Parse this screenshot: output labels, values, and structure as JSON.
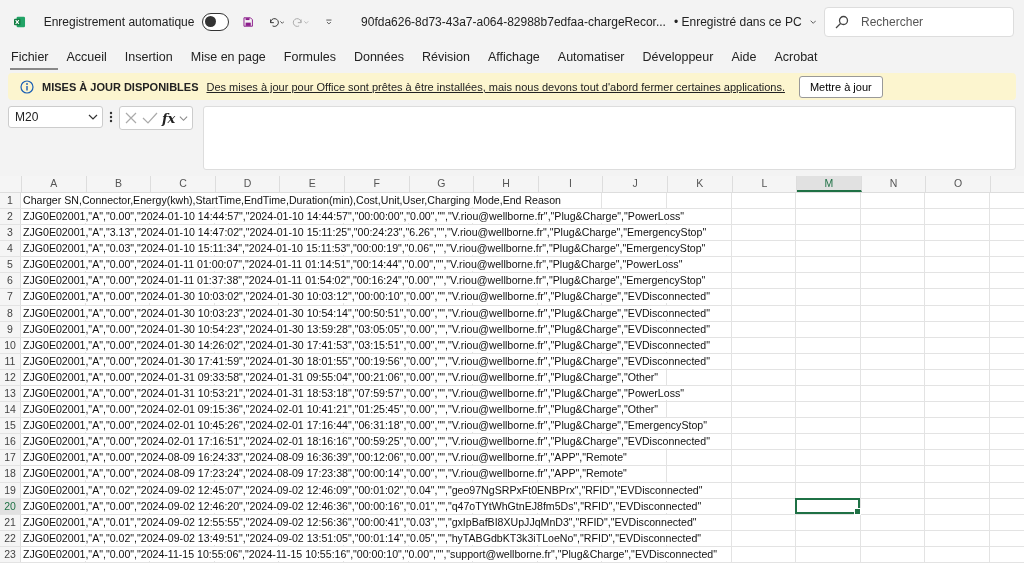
{
  "title_bar": {
    "autosave_label": "Enregistrement automatique",
    "autosave_on": false,
    "file_name": "90fda626-8d73-43a7-a064-82988b7edfaa-chargeRecor...",
    "save_status": "• Enregistré dans ce PC",
    "search": {
      "placeholder": "Rechercher"
    }
  },
  "menu": [
    {
      "label": "Fichier",
      "selected": true
    },
    {
      "label": "Accueil",
      "selected": false
    },
    {
      "label": "Insertion",
      "selected": false
    },
    {
      "label": "Mise en page",
      "selected": false
    },
    {
      "label": "Formules",
      "selected": false
    },
    {
      "label": "Données",
      "selected": false
    },
    {
      "label": "Révision",
      "selected": false
    },
    {
      "label": "Affichage",
      "selected": false
    },
    {
      "label": "Automatiser",
      "selected": false
    },
    {
      "label": "Développeur",
      "selected": false
    },
    {
      "label": "Aide",
      "selected": false
    },
    {
      "label": "Acrobat",
      "selected": false
    }
  ],
  "update_bar": {
    "title": "MISES À JOUR DISPONIBLES",
    "message": "Des mises à jour pour Office sont prêtes à être installées, mais nous devons tout d'abord fermer certaines applications.",
    "button": "Mettre à jour"
  },
  "formula_bar": {
    "name_box": "M20",
    "fx": "fx"
  },
  "columns": [
    {
      "label": "A",
      "selected": false
    },
    {
      "label": "B",
      "selected": false
    },
    {
      "label": "C",
      "selected": false
    },
    {
      "label": "D",
      "selected": false
    },
    {
      "label": "E",
      "selected": false
    },
    {
      "label": "F",
      "selected": false
    },
    {
      "label": "G",
      "selected": false
    },
    {
      "label": "H",
      "selected": false
    },
    {
      "label": "I",
      "selected": false
    },
    {
      "label": "J",
      "selected": false
    },
    {
      "label": "K",
      "selected": false
    },
    {
      "label": "L",
      "selected": false
    },
    {
      "label": "M",
      "selected": true
    },
    {
      "label": "N",
      "selected": false
    },
    {
      "label": "O",
      "selected": false
    }
  ],
  "rows": [
    {
      "number": "1",
      "selected": false,
      "text": "Charger SN,Connector,Energy(kwh),StartTime,EndTime,Duration(min),Cost,Unit,User,Charging Mode,End Reason"
    },
    {
      "number": "2",
      "selected": false,
      "text": "ZJG0E02001,\"A\",\"0.00\",\"2024-01-10 14:44:57\",\"2024-01-10 14:44:57\",\"00:00:00\",\"0.00\",\"\",\"V.riou@wellborne.fr\",\"Plug&Charge\",\"PowerLoss\""
    },
    {
      "number": "3",
      "selected": false,
      "text": "ZJG0E02001,\"A\",\"3.13\",\"2024-01-10 14:47:02\",\"2024-01-10 15:11:25\",\"00:24:23\",\"6.26\",\"\",\"V.riou@wellborne.fr\",\"Plug&Charge\",\"EmergencyStop\""
    },
    {
      "number": "4",
      "selected": false,
      "text": "ZJG0E02001,\"A\",\"0.03\",\"2024-01-10 15:11:34\",\"2024-01-10 15:11:53\",\"00:00:19\",\"0.06\",\"\",\"V.riou@wellborne.fr\",\"Plug&Charge\",\"EmergencyStop\""
    },
    {
      "number": "5",
      "selected": false,
      "text": "ZJG0E02001,\"A\",\"0.00\",\"2024-01-11 01:00:07\",\"2024-01-11 01:14:51\",\"00:14:44\",\"0.00\",\"\",\"V.riou@wellborne.fr\",\"Plug&Charge\",\"PowerLoss\""
    },
    {
      "number": "6",
      "selected": false,
      "text": "ZJG0E02001,\"A\",\"0.00\",\"2024-01-11 01:37:38\",\"2024-01-11 01:54:02\",\"00:16:24\",\"0.00\",\"\",\"V.riou@wellborne.fr\",\"Plug&Charge\",\"EmergencyStop\""
    },
    {
      "number": "7",
      "selected": false,
      "text": "ZJG0E02001,\"A\",\"0.00\",\"2024-01-30 10:03:02\",\"2024-01-30 10:03:12\",\"00:00:10\",\"0.00\",\"\",\"V.riou@wellborne.fr\",\"Plug&Charge\",\"EVDisconnected\""
    },
    {
      "number": "8",
      "selected": false,
      "text": "ZJG0E02001,\"A\",\"0.00\",\"2024-01-30 10:03:23\",\"2024-01-30 10:54:14\",\"00:50:51\",\"0.00\",\"\",\"V.riou@wellborne.fr\",\"Plug&Charge\",\"EVDisconnected\""
    },
    {
      "number": "9",
      "selected": false,
      "text": "ZJG0E02001,\"A\",\"0.00\",\"2024-01-30 10:54:23\",\"2024-01-30 13:59:28\",\"03:05:05\",\"0.00\",\"\",\"V.riou@wellborne.fr\",\"Plug&Charge\",\"EVDisconnected\""
    },
    {
      "number": "10",
      "selected": false,
      "text": "ZJG0E02001,\"A\",\"0.00\",\"2024-01-30 14:26:02\",\"2024-01-30 17:41:53\",\"03:15:51\",\"0.00\",\"\",\"V.riou@wellborne.fr\",\"Plug&Charge\",\"EVDisconnected\""
    },
    {
      "number": "11",
      "selected": false,
      "text": "ZJG0E02001,\"A\",\"0.00\",\"2024-01-30 17:41:59\",\"2024-01-30 18:01:55\",\"00:19:56\",\"0.00\",\"\",\"V.riou@wellborne.fr\",\"Plug&Charge\",\"EVDisconnected\""
    },
    {
      "number": "12",
      "selected": false,
      "text": "ZJG0E02001,\"A\",\"0.00\",\"2024-01-31 09:33:58\",\"2024-01-31 09:55:04\",\"00:21:06\",\"0.00\",\"\",\"V.riou@wellborne.fr\",\"Plug&Charge\",\"Other\""
    },
    {
      "number": "13",
      "selected": false,
      "text": "ZJG0E02001,\"A\",\"0.00\",\"2024-01-31 10:53:21\",\"2024-01-31 18:53:18\",\"07:59:57\",\"0.00\",\"\",\"V.riou@wellborne.fr\",\"Plug&Charge\",\"PowerLoss\""
    },
    {
      "number": "14",
      "selected": false,
      "text": "ZJG0E02001,\"A\",\"0.00\",\"2024-02-01 09:15:36\",\"2024-02-01 10:41:21\",\"01:25:45\",\"0.00\",\"\",\"V.riou@wellborne.fr\",\"Plug&Charge\",\"Other\""
    },
    {
      "number": "15",
      "selected": false,
      "text": "ZJG0E02001,\"A\",\"0.00\",\"2024-02-01 10:45:26\",\"2024-02-01 17:16:44\",\"06:31:18\",\"0.00\",\"\",\"V.riou@wellborne.fr\",\"Plug&Charge\",\"EmergencyStop\""
    },
    {
      "number": "16",
      "selected": false,
      "text": "ZJG0E02001,\"A\",\"0.00\",\"2024-02-01 17:16:51\",\"2024-02-01 18:16:16\",\"00:59:25\",\"0.00\",\"\",\"V.riou@wellborne.fr\",\"Plug&Charge\",\"EVDisconnected\""
    },
    {
      "number": "17",
      "selected": false,
      "text": "ZJG0E02001,\"A\",\"0.00\",\"2024-08-09 16:24:33\",\"2024-08-09 16:36:39\",\"00:12:06\",\"0.00\",\"\",\"V.riou@wellborne.fr\",\"APP\",\"Remote\""
    },
    {
      "number": "18",
      "selected": false,
      "text": "ZJG0E02001,\"A\",\"0.00\",\"2024-08-09 17:23:24\",\"2024-08-09 17:23:38\",\"00:00:14\",\"0.00\",\"\",\"V.riou@wellborne.fr\",\"APP\",\"Remote\""
    },
    {
      "number": "19",
      "selected": false,
      "text": "ZJG0E02001,\"A\",\"0.02\",\"2024-09-02 12:45:07\",\"2024-09-02 12:46:09\",\"00:01:02\",\"0.04\",\"\",\"geo97NgSRPxFt0ENBPrx\",\"RFID\",\"EVDisconnected\""
    },
    {
      "number": "20",
      "selected": true,
      "text": "ZJG0E02001,\"A\",\"0.00\",\"2024-09-02 12:46:20\",\"2024-09-02 12:46:36\",\"00:00:16\",\"0.01\",\"\",\"q47oTYtWhGtnEJ8fm5Ds\",\"RFID\",\"EVDisconnected\""
    },
    {
      "number": "21",
      "selected": false,
      "text": "ZJG0E02001,\"A\",\"0.01\",\"2024-09-02 12:55:55\",\"2024-09-02 12:56:36\",\"00:00:41\",\"0.03\",\"\",\"gxIpBafBI8XUpJJqMnD3\",\"RFID\",\"EVDisconnected\""
    },
    {
      "number": "22",
      "selected": false,
      "text": "ZJG0E02001,\"A\",\"0.02\",\"2024-09-02 13:49:51\",\"2024-09-02 13:51:05\",\"00:01:14\",\"0.05\",\"\",\"hyTABGdbKT3k3iTLoeNo\",\"RFID\",\"EVDisconnected\""
    },
    {
      "number": "23",
      "selected": false,
      "text": "ZJG0E02001,\"A\",\"0.00\",\"2024-11-15 10:55:06\",\"2024-11-15 10:55:16\",\"00:00:10\",\"0.00\",\"\",\"support@wellborne.fr\",\"Plug&Charge\",\"EVDisconnected\""
    }
  ]
}
